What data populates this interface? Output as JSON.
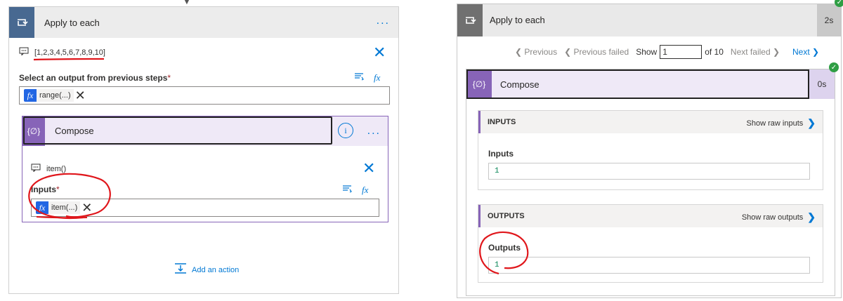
{
  "left_panel": {
    "loop_card": {
      "title": "Apply to each",
      "more_label": "...",
      "comment": "[1,2,3,4,5,6,7,8,9,10]",
      "close_label": "✕",
      "select_label": "Select an output from previous steps",
      "required_mark": "*",
      "token": {
        "fx": "fx",
        "label": "range(...)",
        "remove": "✕"
      }
    },
    "compose_card": {
      "title": "Compose",
      "info_label": "i",
      "more_label": "...",
      "comment": "item()",
      "close_label": "✕",
      "inputs_label": "Inputs",
      "required_mark": "*",
      "token": {
        "fx": "fx",
        "label": "item(...)",
        "remove": "✕"
      }
    },
    "dynamic_content_icon": "dynamic-content-icon",
    "expression_icon_label": "fx",
    "add_action_label": "Add an action"
  },
  "right_panel": {
    "loop_card": {
      "title": "Apply to each",
      "duration": "2s"
    },
    "pager": {
      "previous": "❮ Previous",
      "previous_failed": "❮ Previous failed",
      "show_label": "Show",
      "current": "1",
      "total": "of 10",
      "next_failed": "Next failed ❯",
      "next": "Next ❯"
    },
    "compose_card": {
      "title": "Compose",
      "duration": "0s",
      "inputs_section": {
        "header": "INPUTS",
        "raw_link": "Show raw inputs",
        "label": "Inputs",
        "value": "1"
      },
      "outputs_section": {
        "header": "OUTPUTS",
        "raw_link": "Show raw outputs",
        "label": "Outputs",
        "value": "1"
      }
    }
  },
  "colors": {
    "accent": "#0078d4",
    "loop_tile": "#486991",
    "compose_tile": "#8764b8",
    "success": "#2f9e44",
    "annotation": "#e0161b"
  }
}
